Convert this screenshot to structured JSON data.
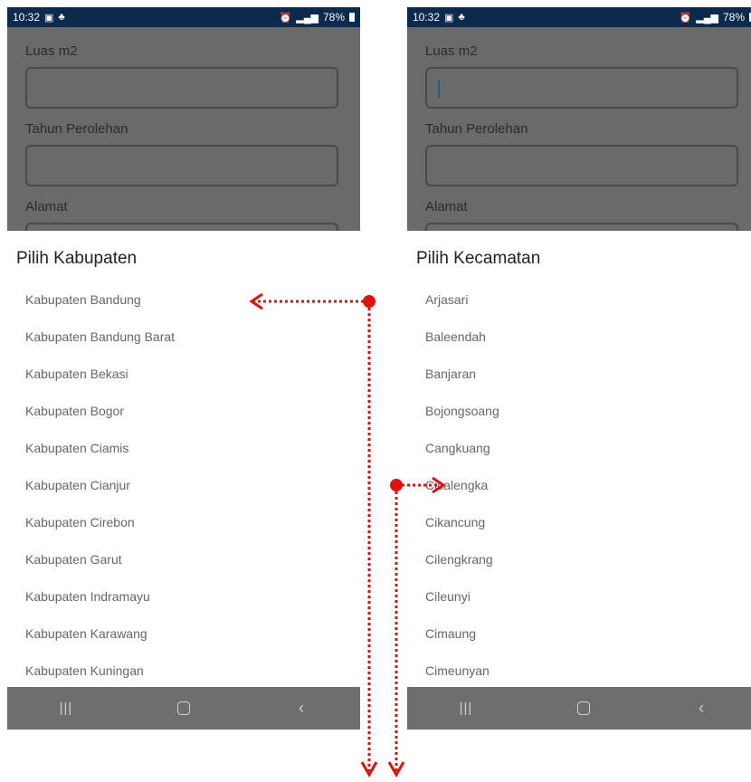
{
  "left_screen": {
    "status": {
      "time": "10:32",
      "battery": "78%"
    },
    "form": {
      "field1_label": "Luas m2",
      "field2_label": "Tahun Perolehan",
      "field3_label": "Alamat"
    },
    "dialog": {
      "title": "Pilih Kabupaten",
      "options": [
        "Kabupaten Bandung",
        "Kabupaten Bandung Barat",
        "Kabupaten Bekasi",
        "Kabupaten Bogor",
        "Kabupaten Ciamis",
        "Kabupaten Cianjur",
        "Kabupaten Cirebon",
        "Kabupaten Garut",
        "Kabupaten Indramayu",
        "Kabupaten Karawang",
        "Kabupaten Kuningan"
      ]
    }
  },
  "right_screen": {
    "status": {
      "time": "10:32",
      "battery": "78%"
    },
    "form": {
      "field1_label": "Luas m2",
      "field2_label": "Tahun Perolehan",
      "field3_label": "Alamat"
    },
    "dialog": {
      "title": "Pilih Kecamatan",
      "options": [
        "Arjasari",
        "Baleendah",
        "Banjaran",
        "Bojongsoang",
        "Cangkuang",
        "Cicalengka",
        "Cikancung",
        "Cilengkrang",
        "Cileunyi",
        "Cimaung",
        "Cimeunyan"
      ]
    }
  },
  "colors": {
    "status_bar": "#0c2a4b",
    "dim_overlay": "#6a6a6a",
    "nav_bar": "#6e6e6e",
    "annotation": "#e01010"
  },
  "icons": {
    "status_left": [
      "gallery-icon",
      "notification-bell-icon"
    ],
    "status_right": [
      "alarm-icon",
      "data-signal-icon",
      "battery-icon"
    ],
    "nav": [
      "recent-apps-icon",
      "home-icon",
      "back-icon"
    ]
  }
}
